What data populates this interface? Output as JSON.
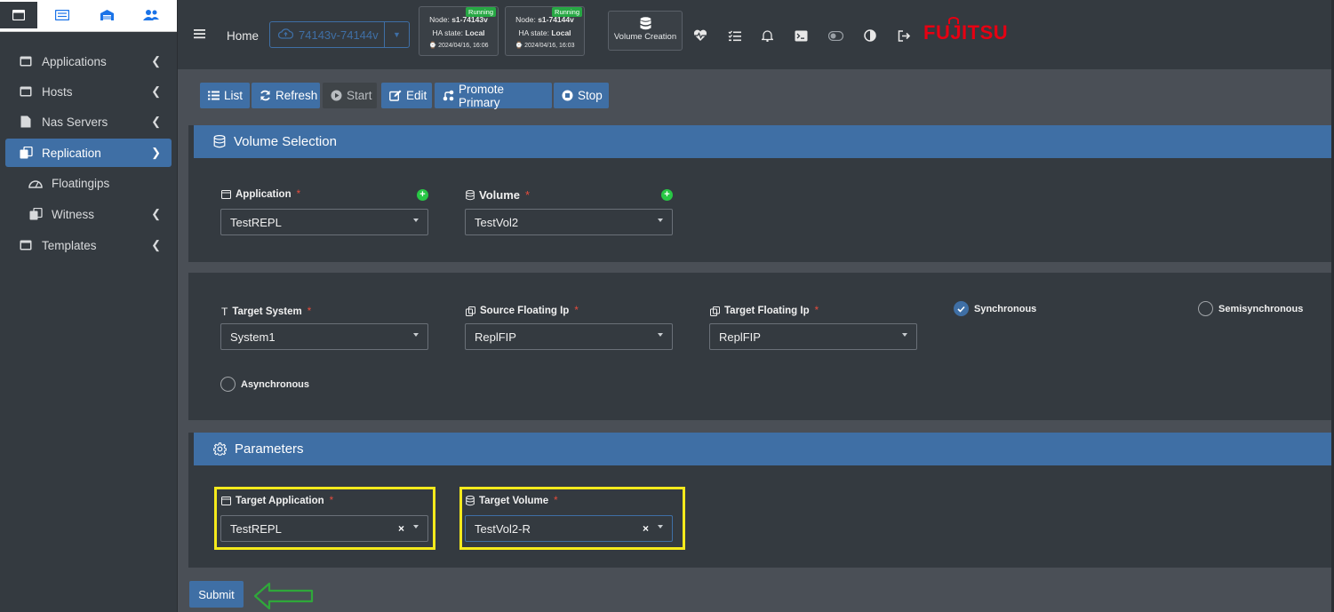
{
  "sidebar": {
    "items": [
      {
        "label": "Applications"
      },
      {
        "label": "Hosts"
      },
      {
        "label": "Nas Servers"
      },
      {
        "label": "Replication"
      },
      {
        "label": "Floatingips"
      },
      {
        "label": "Witness"
      },
      {
        "label": "Templates"
      }
    ]
  },
  "topbar": {
    "home": "Home",
    "system_select": "74143v-74144v",
    "nodes": [
      {
        "status": "Running",
        "node_prefix": "Node: ",
        "node": "s1-74143v",
        "ha_prefix": "HA state: ",
        "ha": "Local",
        "time": "⌚ 2024/04/16, 16:06"
      },
      {
        "status": "Running",
        "node_prefix": "Node: ",
        "node": "s1-74144v",
        "ha_prefix": "HA state: ",
        "ha": "Local",
        "time": "⌚ 2024/04/16, 16:03"
      }
    ],
    "volume_creation": "Volume Creation",
    "brand": "FUJITSU"
  },
  "toolbar": {
    "list": "List",
    "refresh": "Refresh",
    "start": "Start",
    "edit": "Edit",
    "promote": "Promote Primary",
    "stop": "Stop"
  },
  "volume_selection": {
    "title": "Volume Selection",
    "application_label": "Application",
    "application_value": "TestREPL",
    "volume_label": "Volume",
    "volume_value": "TestVol2"
  },
  "replication": {
    "target_system_label": "Target System",
    "target_system_value": "System1",
    "source_fip_label": "Source Floating Ip",
    "source_fip_value": "ReplFIP",
    "target_fip_label": "Target Floating Ip",
    "target_fip_value": "ReplFIP",
    "modes": [
      "Synchronous",
      "Semisynchronous",
      "Asynchronous"
    ],
    "selected_mode": "Synchronous"
  },
  "parameters": {
    "title": "Parameters",
    "target_app_label": "Target Application",
    "target_app_value": "TestREPL",
    "target_volume_label": "Target Volume",
    "target_volume_value": "TestVol2-R"
  },
  "required_mark": "*",
  "submit": "Submit",
  "colors": {
    "accent": "#3f6fa5",
    "highlight": "#f5ea1c",
    "arrow": "#2fa83a",
    "running": "#27a844",
    "brand": "#e60012"
  }
}
